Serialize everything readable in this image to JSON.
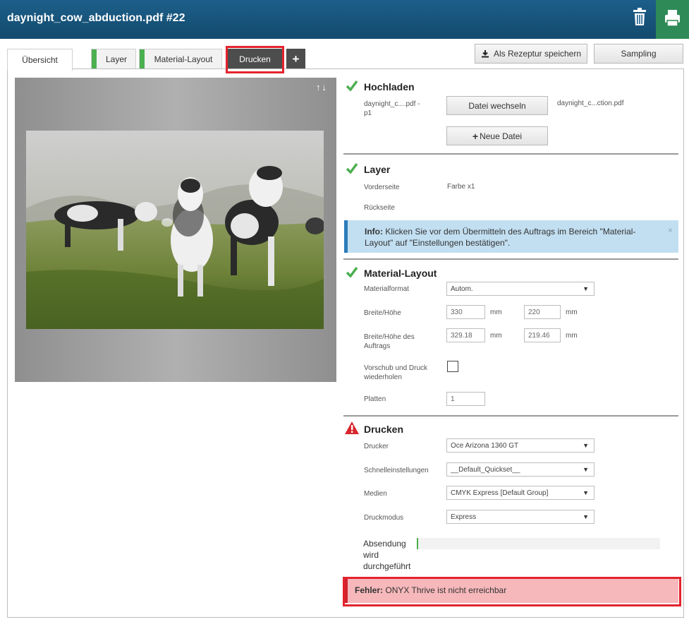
{
  "header": {
    "title": "daynight_cow_abduction.pdf #22",
    "accent": "#1c5f8a",
    "print_button_color": "#2e8b57"
  },
  "tabs": [
    {
      "label": "Übersicht"
    },
    {
      "label": "Layer"
    },
    {
      "label": "Material-Layout"
    },
    {
      "label": "Drucken"
    }
  ],
  "toolbar": {
    "save_recipe_label": "Als Rezeptur speichern",
    "sampling_label": "Sampling"
  },
  "upload": {
    "title": "Hochladen",
    "file_short": "daynight_c....pdf -\np1",
    "change_file_label": "Datei wechseln",
    "new_file_label": "Neue Datei",
    "file_name": "daynight_c...ction.pdf"
  },
  "layer": {
    "title": "Layer",
    "front_label": "Vorderseite",
    "front_value": "Farbe x1",
    "back_label": "Rückseite"
  },
  "info": {
    "label": "Info:",
    "text": "Klicken Sie vor dem Übermitteln des Auftrags im Bereich \"Material-Layout\" auf \"Einstellungen bestätigen\".",
    "close": "×"
  },
  "material": {
    "title": "Material-Layout",
    "format_label": "Materialformat",
    "format_value": "Autom.",
    "size_label": "Breite/Höhe",
    "width": "330",
    "height": "220",
    "unit": "mm",
    "job_size_label": "Breite/Höhe des Auftrags",
    "job_width": "329.18",
    "job_height": "219.46",
    "repeat_label": "Vorschub und Druck wiederholen",
    "plates_label": "Platten",
    "plates_value": "1"
  },
  "print": {
    "title": "Drucken",
    "printer_label": "Drucker",
    "printer_value": "Oce Arizona 1360 GT",
    "quick_label": "Schnelleinstellungen",
    "quick_value": "__Default_Quickset__",
    "media_label": "Medien",
    "media_value": "CMYK Express [Default Group]",
    "mode_label": "Druckmodus",
    "mode_value": "Express",
    "progress_label": "Absendung wird durchgeführt",
    "progress": 0
  },
  "error": {
    "label": "Fehler:",
    "text": "ONYX Thrive ist nicht erreichbar"
  }
}
